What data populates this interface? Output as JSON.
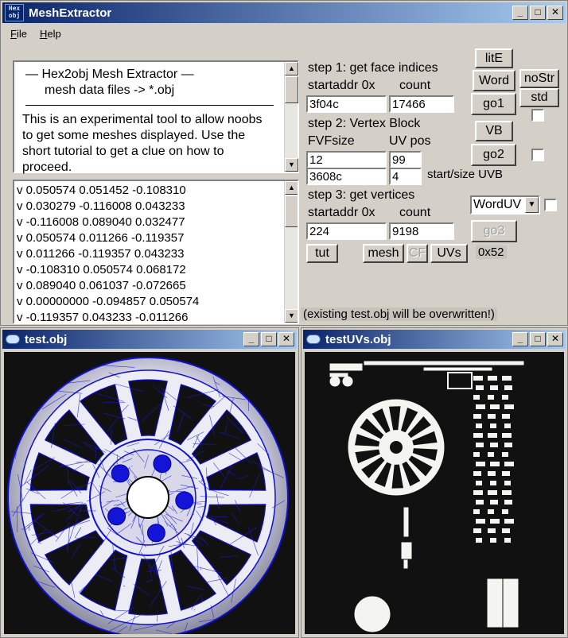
{
  "main_window": {
    "title": "MeshExtractor",
    "icon_text_top": "Hex",
    "icon_text_bottom": "obj",
    "menu": {
      "file": "File",
      "help": "Help"
    },
    "controls": {
      "minimize": "_",
      "maximize": "□",
      "close": "✕"
    }
  },
  "info": {
    "line1": "—   Hex2obj Mesh Extractor   —",
    "line2": "mesh data files -> *.obj",
    "body": "This is an experimental tool to allow noobs to get some meshes displayed. Use the short tutorial to get a clue on how to proceed."
  },
  "vertices": [
    "v 0.050574 0.051452 -0.108310",
    "v 0.030279 -0.116008 0.043233",
    "v -0.116008 0.089040 0.032477",
    "v 0.050574 0.011266 -0.119357",
    "v 0.011266 -0.119357 0.043233",
    "v -0.108310 0.050574 0.068172",
    "v 0.089040 0.061037 -0.072665",
    "v 0.00000000 -0.094857 0.050574",
    "v -0.119357 0.043233 -0.011266"
  ],
  "step1": {
    "title": "step 1: get face indices",
    "addr_label": "startaddr 0x",
    "count_label": "count",
    "addr": "3f04c",
    "count": "17466"
  },
  "step2": {
    "title": "step 2: Vertex Block",
    "fvf_label": "FVFsize",
    "uv_label": "UV pos",
    "fvf": "12",
    "uv": "99",
    "uvb_start": "3608c",
    "uvb_size": "4",
    "uvb_label": "start/size UVB"
  },
  "step3": {
    "title": "step 3: get vertices",
    "addr_label": "startaddr 0x",
    "count_label": "count",
    "addr": "224",
    "count": "9198"
  },
  "buttons": {
    "lite": "litE",
    "word": "Word",
    "nostr": "noStr",
    "std": "std",
    "go1": "go1",
    "vb": "VB",
    "go2": "go2",
    "go3": "go3",
    "tut": "tut",
    "mesh": "mesh",
    "cf": "CF",
    "uvs": "UVs"
  },
  "uv_select": "WordUV",
  "hex_display": "0x52",
  "warning": "(existing test.obj will be overwritten!)",
  "viewer_test": {
    "title": "test.obj"
  },
  "viewer_uvs": {
    "title": "testUVs.obj"
  }
}
